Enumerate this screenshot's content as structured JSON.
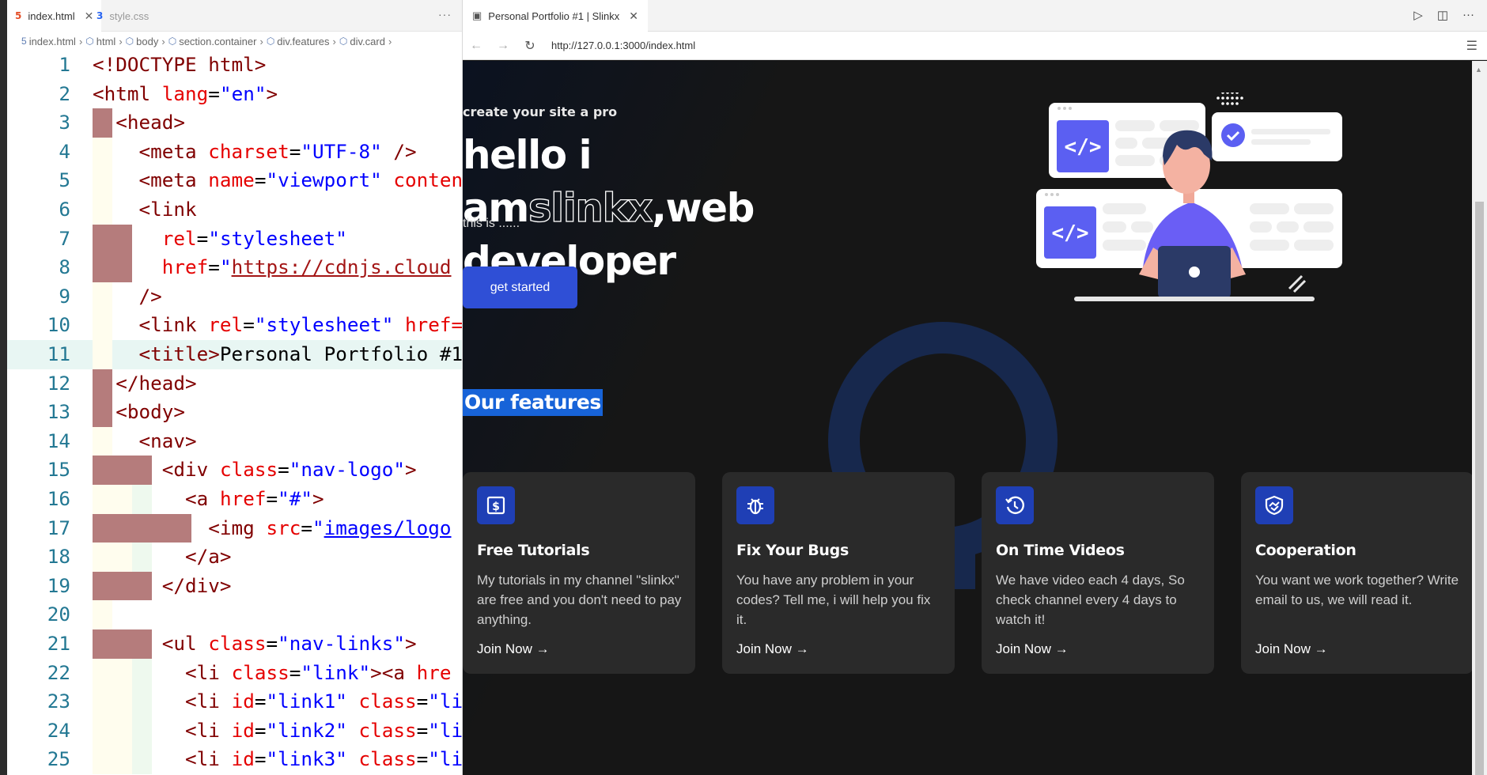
{
  "editor": {
    "tabs": [
      {
        "label": "index.html",
        "icon": "html-file-icon",
        "active": true
      },
      {
        "label": "style.css",
        "icon": "css-file-icon",
        "active": false
      }
    ],
    "more_label": "···",
    "breadcrumb": [
      "index.html",
      "html",
      "body",
      "section.container",
      "div.features",
      "div.card"
    ],
    "lines": [
      {
        "n": "1",
        "html": "<span class='tk-tag'>&lt;!DOCTYPE html&gt;</span>"
      },
      {
        "n": "2",
        "html": "<span class='tk-tag'>&lt;html</span> <span class='tk-attr'>lang</span>=<span class='tk-str'>\"en\"</span><span class='tk-tag'>&gt;</span>"
      },
      {
        "n": "3",
        "html": "  <span class='tk-tag'>&lt;head&gt;</span>"
      },
      {
        "n": "4",
        "html": "    <span class='tk-tag'>&lt;meta</span> <span class='tk-attr'>charset</span>=<span class='tk-str'>\"UTF-8\"</span> <span class='tk-tag'>/&gt;</span>"
      },
      {
        "n": "5",
        "html": "    <span class='tk-tag'>&lt;meta</span> <span class='tk-attr'>name</span>=<span class='tk-str'>\"viewport\"</span> <span class='tk-attr'>conten</span>"
      },
      {
        "n": "6",
        "html": "    <span class='tk-tag'>&lt;link</span>"
      },
      {
        "n": "7",
        "html": "      <span class='tk-attr'>rel</span>=<span class='tk-str'>\"stylesheet\"</span>"
      },
      {
        "n": "8",
        "html": "      <span class='tk-attr'>href</span>=<span class='tk-str'>\"</span><span class='tk-url red'>https://cdnjs.cloud</span>"
      },
      {
        "n": "9",
        "html": "    <span class='tk-tag'>/&gt;</span>"
      },
      {
        "n": "10",
        "html": "    <span class='tk-tag'>&lt;link</span> <span class='tk-attr'>rel</span>=<span class='tk-str'>\"stylesheet\"</span> <span class='tk-attr'>href=</span>"
      },
      {
        "n": "11",
        "html": "    <span class='tk-tag'>&lt;title&gt;</span><span class='tk-txt'>Personal Portfolio #1</span>"
      },
      {
        "n": "12",
        "html": "  <span class='tk-tag'>&lt;/head&gt;</span>"
      },
      {
        "n": "13",
        "html": "  <span class='tk-tag'>&lt;body&gt;</span>"
      },
      {
        "n": "14",
        "html": "    <span class='tk-tag'>&lt;nav&gt;</span>"
      },
      {
        "n": "15",
        "html": "      <span class='tk-tag'>&lt;div</span> <span class='tk-attr'>class</span>=<span class='tk-str'>\"nav-logo\"</span><span class='tk-tag'>&gt;</span>"
      },
      {
        "n": "16",
        "html": "        <span class='tk-tag'>&lt;a</span> <span class='tk-attr'>href</span>=<span class='tk-str'>\"#\"</span><span class='tk-tag'>&gt;</span>"
      },
      {
        "n": "17",
        "html": "          <span class='tk-tag'>&lt;img</span> <span class='tk-attr'>src</span>=<span class='tk-str'>\"</span><span class='tk-url'>images/logo</span>"
      },
      {
        "n": "18",
        "html": "        <span class='tk-tag'>&lt;/a&gt;</span>"
      },
      {
        "n": "19",
        "html": "      <span class='tk-tag'>&lt;/div&gt;</span>"
      },
      {
        "n": "20",
        "html": ""
      },
      {
        "n": "21",
        "html": "      <span class='tk-tag'>&lt;ul</span> <span class='tk-attr'>class</span>=<span class='tk-str'>\"nav-links\"</span><span class='tk-tag'>&gt;</span>"
      },
      {
        "n": "22",
        "html": "        <span class='tk-tag'>&lt;li</span> <span class='tk-attr'>class</span>=<span class='tk-str'>\"link\"</span><span class='tk-tag'>&gt;&lt;a</span> <span class='tk-attr'>hre</span>"
      },
      {
        "n": "23",
        "html": "        <span class='tk-tag'>&lt;li</span> <span class='tk-attr'>id</span>=<span class='tk-str'>\"link1\"</span> <span class='tk-attr'>class</span>=<span class='tk-str'>\"li</span>"
      },
      {
        "n": "24",
        "html": "        <span class='tk-tag'>&lt;li</span> <span class='tk-attr'>id</span>=<span class='tk-str'>\"link2\"</span> <span class='tk-attr'>class</span>=<span class='tk-str'>\"li</span>"
      },
      {
        "n": "25",
        "html": "        <span class='tk-tag'>&lt;li</span> <span class='tk-attr'>id</span>=<span class='tk-str'>\"link3\"</span> <span class='tk-attr'>class</span>=<span class='tk-str'>\"li</span>"
      }
    ]
  },
  "browser": {
    "tab_title": "Personal Portfolio #1 | Slinkx",
    "url": "http://127.0.0.1:3000/index.html"
  },
  "site": {
    "tagline": "create your site a pro",
    "hero_line1_a": "hello i am",
    "hero_name": "slinkx",
    "hero_line1_b": ",web",
    "hero_line2": "developer",
    "sub": "this is ......",
    "cta": "get started",
    "features_title": "Our features",
    "cards": [
      {
        "title": "Free Tutorials",
        "text": "My tutorials in my channel \"slinkx\" are free and you don't need to pay anything.",
        "link": "Join Now →",
        "icon": "dollar-icon"
      },
      {
        "title": "Fix Your Bugs",
        "text": "You have any problem in your codes? Tell me, i will help you fix it.",
        "link": "Join Now →",
        "icon": "bug-icon"
      },
      {
        "title": "On Time Videos",
        "text": "We have video each 4 days, So check channel every 4 days to watch it!",
        "link": "Join Now →",
        "icon": "history-icon"
      },
      {
        "title": "Cooperation",
        "text": "You want we work together? Write email to us, we will read it.",
        "link": "Join Now →",
        "icon": "handshake-icon"
      }
    ],
    "illustration_code_symbol": "</>"
  }
}
